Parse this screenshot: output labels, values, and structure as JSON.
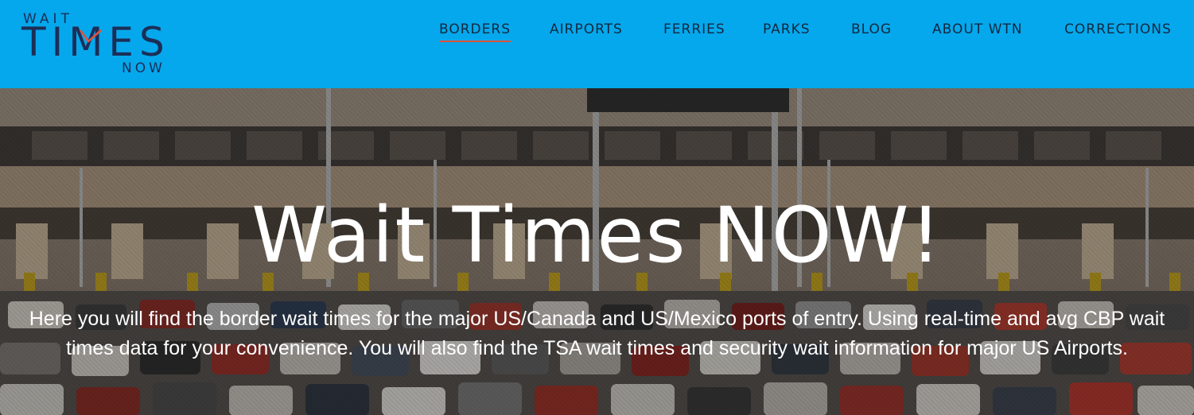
{
  "logo": {
    "line1": "WAIT",
    "line2": "TIMES",
    "line3": "NOW"
  },
  "nav": {
    "items": [
      {
        "label": "BORDERS",
        "active": true
      },
      {
        "label": "AIRPORTS",
        "active": false
      },
      {
        "label": "FERRIES",
        "active": false
      },
      {
        "label": "PARKS",
        "active": false
      },
      {
        "label": "BLOG",
        "active": false
      },
      {
        "label": "ABOUT WTN",
        "active": false
      },
      {
        "label": "CORRECTIONS",
        "active": false
      }
    ]
  },
  "hero": {
    "title": "Wait Times NOW!",
    "description": "Here you will find the border wait times for the major US/Canada and US/Mexico ports of entry. Using real-time and avg CBP wait times data for your convenience. You will also find the TSA wait times and security wait information for major US Airports."
  },
  "colors": {
    "header_bg": "#05a8ec",
    "logo_navy": "#1c2e57",
    "active_underline": "#e2513a",
    "text_white": "#ffffff"
  }
}
